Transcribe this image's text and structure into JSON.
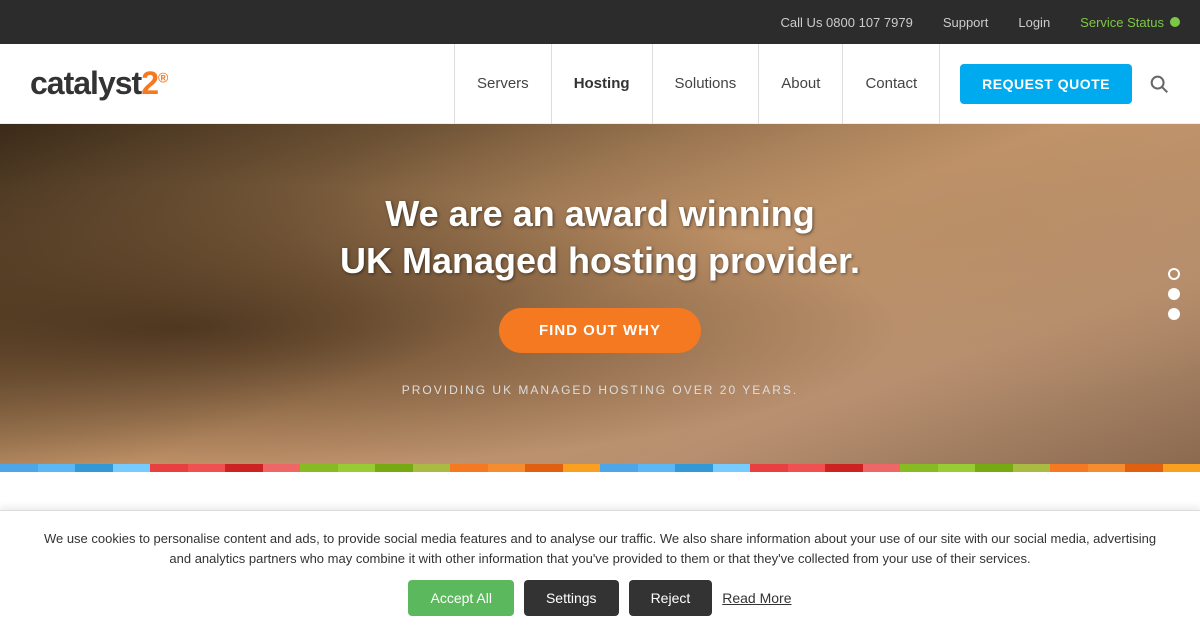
{
  "topbar": {
    "phone_label": "Call Us 0800 107 7979",
    "support_label": "Support",
    "login_label": "Login",
    "service_status_label": "Service Status",
    "status_color": "#7dc843"
  },
  "nav": {
    "logo_catalyst": "catalyst",
    "logo_2": "2",
    "items": [
      {
        "label": "Servers"
      },
      {
        "label": "Hosting"
      },
      {
        "label": "Solutions"
      },
      {
        "label": "About"
      },
      {
        "label": "Contact"
      }
    ],
    "cta_label": "REQUEST QUOTE"
  },
  "hero": {
    "title_line1": "We are an award winning",
    "title_line2": "UK Managed hosting provider.",
    "cta_label": "FIND OUT WHY",
    "subtitle": "PROVIDING UK MANAGED HOSTING OVER 20 YEARS."
  },
  "slider": {
    "dots": [
      "empty",
      "filled",
      "filled"
    ]
  },
  "color_bar": {
    "segments": [
      "#4da6e8",
      "#5bb8f5",
      "#3399d6",
      "#77ccff",
      "#e84040",
      "#f05050",
      "#cc2222",
      "#ee6666",
      "#88bb22",
      "#99cc33",
      "#77aa11",
      "#aabb44",
      "#f47920",
      "#f58c30",
      "#e06010",
      "#f9a020",
      "#4da6e8",
      "#5bb8f5",
      "#3399d6",
      "#77ccff",
      "#e84040",
      "#f05050",
      "#cc2222",
      "#ee6666",
      "#88bb22",
      "#99cc33",
      "#77aa11",
      "#aabb44",
      "#f47920",
      "#f58c30",
      "#e06010",
      "#f9a020"
    ]
  },
  "cookie": {
    "text": "We use cookies to personalise content and ads, to provide social media features and to analyse our traffic. We also share information about your use of our site with our social media, advertising and analytics partners who may combine it with other information that you've provided to them or that they've collected from your use of their services.",
    "accept_label": "Accept All",
    "settings_label": "Settings",
    "reject_label": "Reject",
    "read_more_label": "Read More"
  }
}
